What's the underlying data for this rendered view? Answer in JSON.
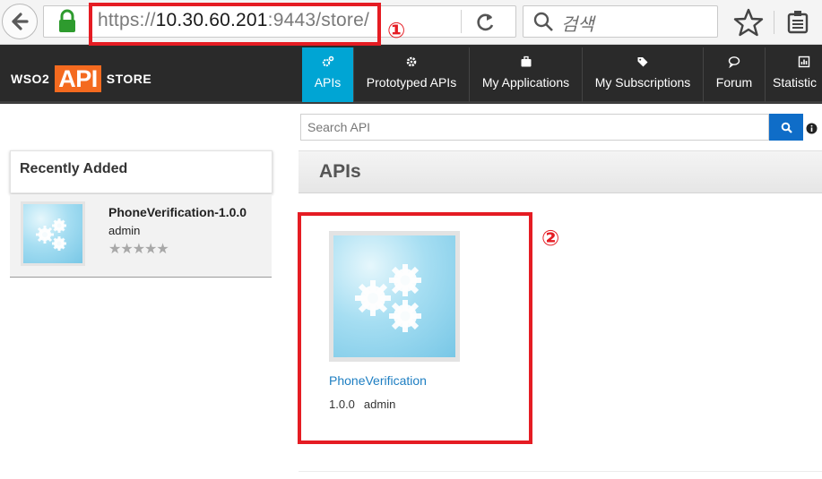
{
  "browser": {
    "url_scheme": "https://",
    "url_host": "10.30.60.201",
    "url_rest": ":9443/store/",
    "search_placeholder": "검색",
    "icons": [
      "back-arrow-icon",
      "lock-icon",
      "reload-icon",
      "search-icon",
      "star-icon",
      "reader-icon"
    ]
  },
  "header": {
    "logo_left": "WSO2",
    "logo_mid": "API",
    "logo_right": "STORE",
    "nav": [
      {
        "label": "APIs",
        "icon": "gears-icon",
        "active": true
      },
      {
        "label": "Prototyped APIs",
        "icon": "gear-icon"
      },
      {
        "label": "My Applications",
        "icon": "briefcase-icon"
      },
      {
        "label": "My Subscriptions",
        "icon": "tag-icon"
      },
      {
        "label": "Forum",
        "icon": "comment-icon"
      },
      {
        "label": "Statistic",
        "icon": "chart-icon"
      }
    ],
    "accent_color": "#00a5d4",
    "brand_color": "#f46a1f"
  },
  "search": {
    "placeholder": "Search API"
  },
  "sidebar": {
    "title": "Recently Added",
    "items": [
      {
        "name": "PhoneVerification-1.0.0",
        "owner": "admin",
        "rating_stars": "★★★★★",
        "rating": 0
      }
    ]
  },
  "main": {
    "title": "APIs",
    "apis": [
      {
        "name": "PhoneVerification",
        "version": "1.0.0",
        "owner": "admin"
      }
    ]
  },
  "annotations": {
    "one": "①",
    "two": "②",
    "color": "#e51c23"
  }
}
